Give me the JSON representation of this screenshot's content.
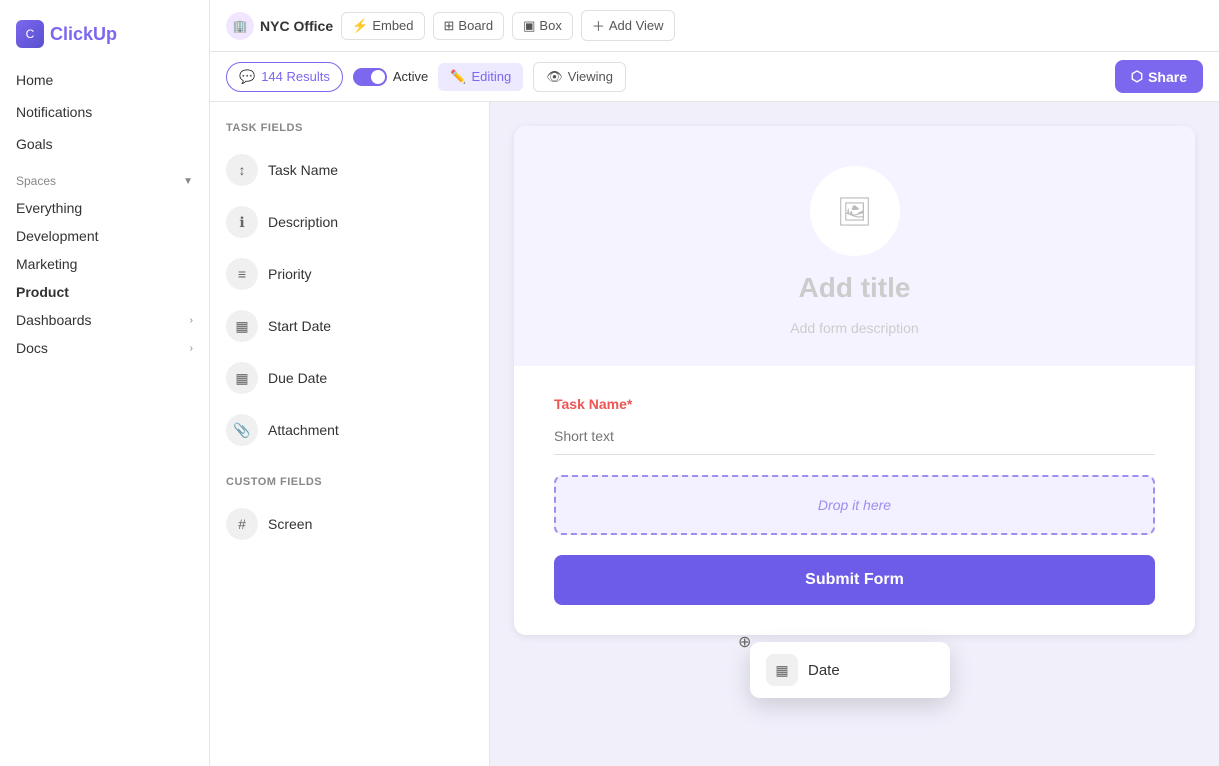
{
  "sidebar": {
    "logo": "ClickUp",
    "nav_items": [
      {
        "label": "Home",
        "id": "home"
      },
      {
        "label": "Notifications",
        "id": "notifications"
      },
      {
        "label": "Goals",
        "id": "goals"
      }
    ],
    "spaces_section": "Spaces",
    "space_items": [
      {
        "label": "Everything",
        "id": "everything"
      },
      {
        "label": "Development",
        "id": "development"
      },
      {
        "label": "Marketing",
        "id": "marketing"
      },
      {
        "label": "Product",
        "id": "product",
        "bold": true
      }
    ],
    "dashboards_label": "Dashboards",
    "docs_label": "Docs"
  },
  "topbar": {
    "workspace_name": "NYC Office",
    "workspace_icon": "🏢",
    "buttons": [
      {
        "label": "Embed",
        "id": "embed"
      },
      {
        "label": "Board",
        "id": "board"
      },
      {
        "label": "Box",
        "id": "box"
      },
      {
        "label": "Add View",
        "id": "add-view"
      }
    ]
  },
  "subtoolbar": {
    "results_count": "144 Results",
    "active_label": "Active",
    "editing_label": "Editing",
    "viewing_label": "Viewing",
    "share_label": "Share"
  },
  "fields_panel": {
    "task_fields_title": "TASK FIELDS",
    "task_fields": [
      {
        "label": "Task Name",
        "icon": "↕",
        "id": "task-name"
      },
      {
        "label": "Description",
        "icon": "ℹ",
        "id": "description"
      },
      {
        "label": "Priority",
        "icon": "≡",
        "id": "priority"
      },
      {
        "label": "Start Date",
        "icon": "📅",
        "id": "start-date"
      },
      {
        "label": "Due Date",
        "icon": "📅",
        "id": "due-date"
      },
      {
        "label": "Attachment",
        "icon": "📎",
        "id": "attachment"
      }
    ],
    "custom_fields_title": "CUSTOM FIELDS",
    "custom_fields": [
      {
        "label": "Screen",
        "icon": "#",
        "id": "screen"
      }
    ]
  },
  "form": {
    "title_placeholder": "Add title",
    "desc_placeholder": "Add form description",
    "field_label": "Task Name",
    "field_required": "*",
    "input_placeholder": "Short text",
    "drop_zone_label": "Drop it here",
    "submit_label": "Submit Form"
  },
  "drag_item": {
    "label": "Date",
    "move_icon": "⊕"
  },
  "colors": {
    "accent": "#7b68ee",
    "accent_dark": "#6c5ce7",
    "drop_zone_border": "#9b8fef",
    "drop_zone_bg": "#f3f0ff"
  }
}
